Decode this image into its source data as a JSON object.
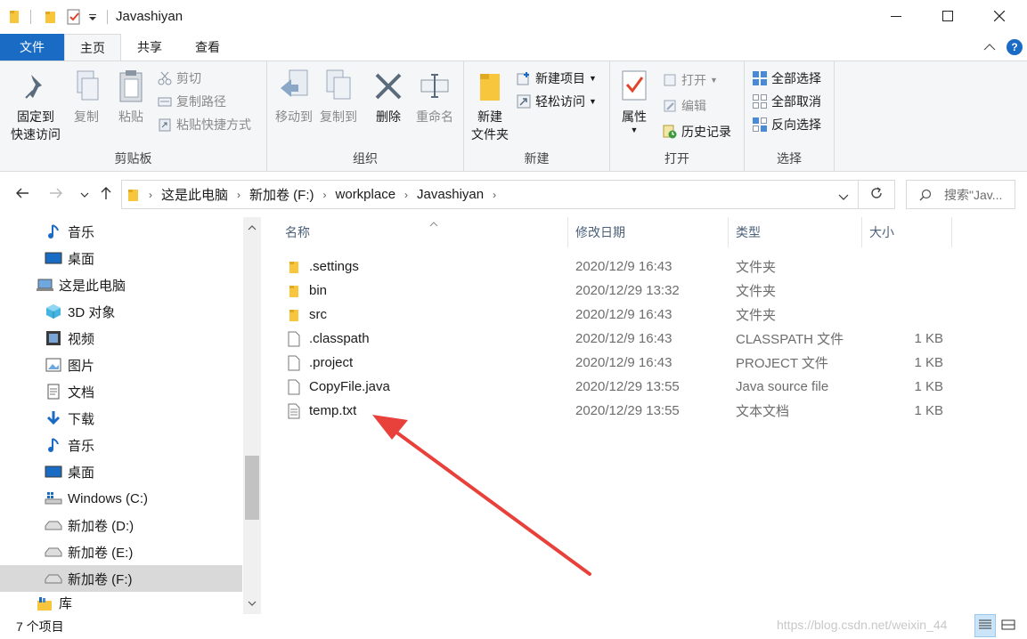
{
  "window": {
    "title": "Javashiyan",
    "minimize_icon": "minimize-icon",
    "maximize_icon": "maximize-icon",
    "close_icon": "close-icon"
  },
  "tabs": [
    {
      "label": "文件"
    },
    {
      "label": "主页"
    },
    {
      "label": "共享"
    },
    {
      "label": "查看"
    }
  ],
  "help_label": "?",
  "ribbon": {
    "clipboard": {
      "label": "剪贴板",
      "pin": "固定到",
      "pin2": "快速访问",
      "copy": "复制",
      "paste": "粘贴",
      "cut": "剪切",
      "copy_path": "复制路径",
      "paste_shortcut": "粘贴快捷方式"
    },
    "organize": {
      "label": "组织",
      "move_to": "移动到",
      "copy_to": "复制到",
      "delete": "删除",
      "rename": "重命名"
    },
    "new": {
      "label": "新建",
      "new_folder": "新建",
      "new_folder2": "文件夹",
      "new_item": "新建项目",
      "easy_access": "轻松访问"
    },
    "open": {
      "label": "打开",
      "properties": "属性",
      "open": "打开",
      "edit": "编辑",
      "history": "历史记录"
    },
    "select": {
      "label": "选择",
      "select_all": "全部选择",
      "select_none": "全部取消",
      "invert": "反向选择"
    }
  },
  "address": {
    "crumbs": [
      "这是此电脑",
      "新加卷 (F:)",
      "workplace",
      "Javashiyan"
    ],
    "search_placeholder": "搜索\"Jav..."
  },
  "nav_pane": {
    "items": [
      {
        "label": "音乐",
        "icon": "music-icon"
      },
      {
        "label": "桌面",
        "icon": "desktop-icon"
      },
      {
        "label": "这是此电脑",
        "icon": "computer-icon"
      },
      {
        "label": "3D 对象",
        "icon": "3d-objects-icon"
      },
      {
        "label": "视频",
        "icon": "video-icon"
      },
      {
        "label": "图片",
        "icon": "pictures-icon"
      },
      {
        "label": "文档",
        "icon": "documents-icon"
      },
      {
        "label": "下载",
        "icon": "download-icon"
      },
      {
        "label": "音乐",
        "icon": "music-icon"
      },
      {
        "label": "桌面",
        "icon": "desktop-icon"
      },
      {
        "label": "Windows (C:)",
        "icon": "windows-drive-icon"
      },
      {
        "label": "新加卷 (D:)",
        "icon": "drive-icon"
      },
      {
        "label": "新加卷 (E:)",
        "icon": "drive-icon"
      },
      {
        "label": "新加卷 (F:)",
        "icon": "drive-icon"
      },
      {
        "label": "库",
        "icon": "library-icon"
      }
    ]
  },
  "columns": {
    "name": "名称",
    "date": "修改日期",
    "type": "类型",
    "size": "大小"
  },
  "files": [
    {
      "name": ".settings",
      "date": "2020/12/9 16:43",
      "type": "文件夹",
      "size": "",
      "kind": "folder"
    },
    {
      "name": "bin",
      "date": "2020/12/29 13:32",
      "type": "文件夹",
      "size": "",
      "kind": "folder"
    },
    {
      "name": "src",
      "date": "2020/12/9 16:43",
      "type": "文件夹",
      "size": "",
      "kind": "folder"
    },
    {
      "name": ".classpath",
      "date": "2020/12/9 16:43",
      "type": "CLASSPATH 文件",
      "size": "1 KB",
      "kind": "file"
    },
    {
      "name": ".project",
      "date": "2020/12/9 16:43",
      "type": "PROJECT 文件",
      "size": "1 KB",
      "kind": "file"
    },
    {
      "name": "CopyFile.java",
      "date": "2020/12/29 13:55",
      "type": "Java source file",
      "size": "1 KB",
      "kind": "file"
    },
    {
      "name": "temp.txt",
      "date": "2020/12/29 13:55",
      "type": "文本文档",
      "size": "1 KB",
      "kind": "text"
    }
  ],
  "status": {
    "count": "7 个项目",
    "watermark": "https://blog.csdn.net/weixin_44"
  },
  "colors": {
    "accent": "#1a6bc4",
    "folder": "#f8c63d",
    "annotation_arrow": "#e8403a"
  }
}
